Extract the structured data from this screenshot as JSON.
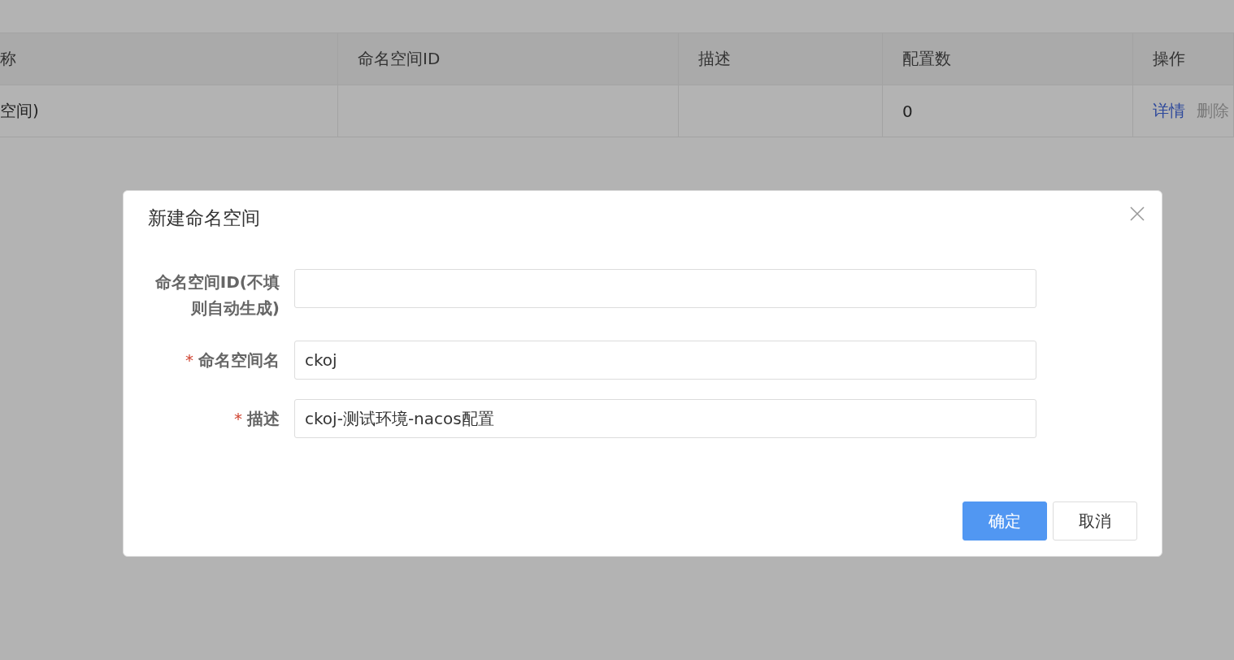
{
  "table": {
    "columns": [
      "称",
      "命名空间ID",
      "描述",
      "配置数",
      "操作"
    ],
    "rows": [
      {
        "name": "空间)",
        "config_count": "0",
        "actions": [
          {
            "label": "详情",
            "kind": "link"
          },
          {
            "label": "删除",
            "kind": "muted"
          }
        ]
      }
    ]
  },
  "dialog": {
    "title": "新建命名空间",
    "fields": [
      {
        "label": "命名空间ID(不填则自动生成)"
      },
      {
        "required_mark": "*",
        "label": "命名空间名",
        "value": "ckoj"
      },
      {
        "required_mark": "*",
        "label": "描述",
        "value": "ckoj-测试环境-nacos配置"
      }
    ],
    "buttons": [
      {
        "label": "确定",
        "primary": true
      },
      {
        "label": "取消",
        "primary": false
      }
    ]
  }
}
